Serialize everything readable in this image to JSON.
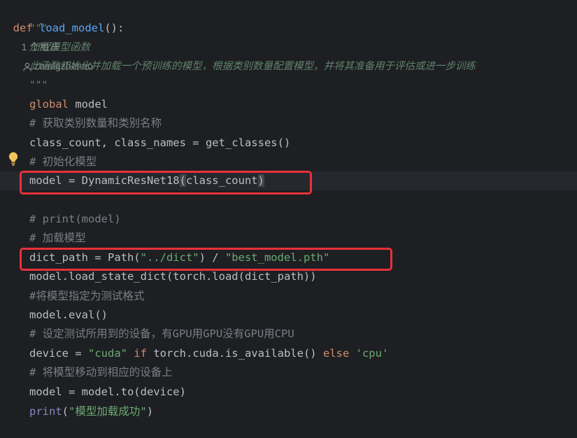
{
  "def_line": {
    "keyword": "def",
    "name": "load_model",
    "sig": "():",
    "usage_hint": "1 个用法",
    "author": "zhangzhehao"
  },
  "doc": {
    "open": "\"\"\"",
    "line1": "加载模型函数",
    "line2": "此函数初始化并加载一个预训练的模型，根据类别数量配置模型，并将其准备用于评估或进一步训练",
    "close": "\"\"\""
  },
  "code": {
    "global_kw": "global",
    "global_rest": " model",
    "c1": "# 获取类别数量和类别名称",
    "l_get": "class_count, class_names = get_classes()",
    "c2": "# 初始化模型",
    "l_model_a": "model = DynamicResNet18",
    "l_model_p1": "(",
    "l_model_b": "class_count",
    "l_model_p2": ")",
    "c3": "# print(model)",
    "c4": "# 加载模型",
    "l_dict_a": "dict_path = Path(",
    "l_dict_s1": "\"../dict\"",
    "l_dict_b": ") / ",
    "l_dict_s2": "\"best_model.pth\"",
    "l_load": "model.load_state_dict(torch.load(dict_path))",
    "c5": "#将模型指定为测试格式",
    "l_eval": "model.eval()",
    "c6": "# 设定测试所用到的设备，有GPU用GPU没有GPU用CPU",
    "l_dev_a": "device = ",
    "l_dev_s1": "\"cuda\"",
    "l_dev_if": " if ",
    "l_dev_b": "torch.cuda.is_available()",
    "l_dev_else": " else ",
    "l_dev_s2": "'cpu'",
    "c7": "# 将模型移动到相应的设备上",
    "l_to": "model = model.to(device)",
    "l_print_fn": "print",
    "l_print_p1": "(",
    "l_print_s": "\"模型加载成功\"",
    "l_print_p2": ")"
  },
  "colors": {
    "background": "#1e1f22",
    "keyword": "#cf8e6d",
    "function": "#56a8f5",
    "string": "#6aab73",
    "comment": "#7a7e85",
    "docstring": "#5f826b",
    "highlight_box": "#e8313a",
    "bulb": "#f2c55c"
  },
  "icons": [
    "person-icon",
    "lightbulb-icon"
  ]
}
